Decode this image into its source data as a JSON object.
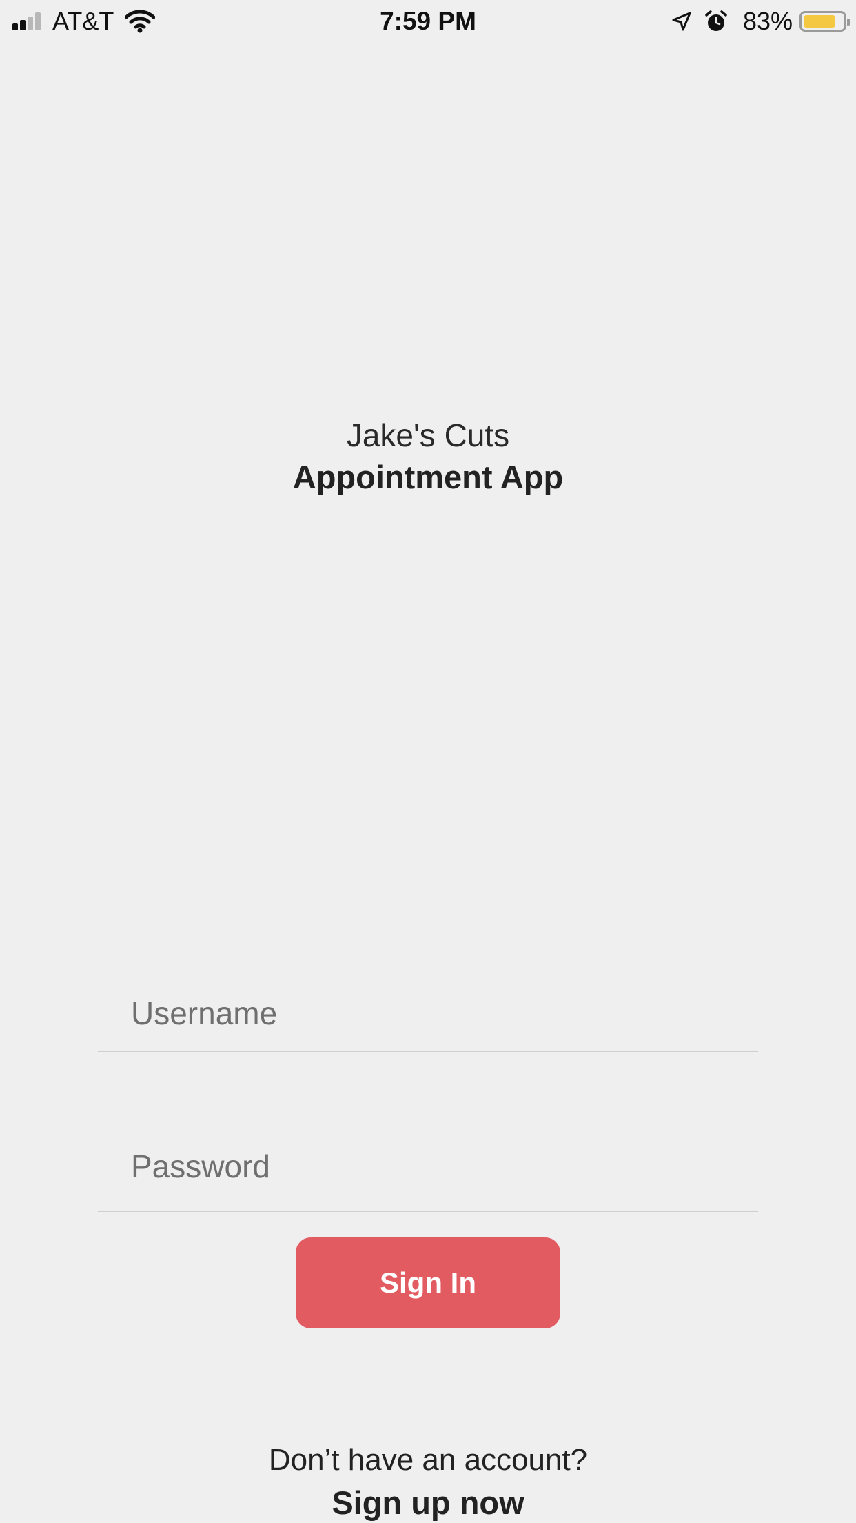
{
  "status_bar": {
    "carrier": "AT&T",
    "time": "7:59 PM",
    "battery_percent_label": "83%",
    "battery_level": 0.83,
    "battery_color": "#f5c842",
    "icons": [
      "signal-icon",
      "wifi-icon",
      "location-arrow-icon",
      "alarm-clock-icon",
      "battery-icon"
    ]
  },
  "header": {
    "subtitle": "Jake's Cuts",
    "title": "Appointment App"
  },
  "form": {
    "username_placeholder": "Username",
    "password_placeholder": "Password",
    "signin_label": "Sign In"
  },
  "footer": {
    "account_prompt": "Don’t have an account?",
    "signup_label": "Sign up now"
  },
  "colors": {
    "background": "#efefef",
    "accent": "#e15b61",
    "text": "#222222",
    "placeholder": "#6f6f6f",
    "divider": "#cfcfcf"
  }
}
